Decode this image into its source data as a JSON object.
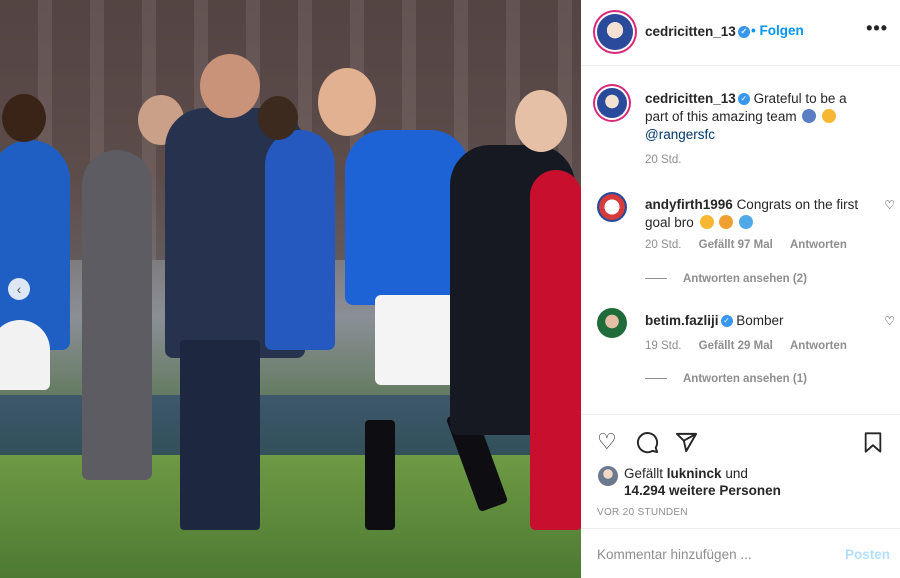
{
  "post": {
    "author": "cedricitten_13",
    "follow_label": "Folgen",
    "more_label": "•••",
    "nav_prev": "‹"
  },
  "comments": [
    {
      "user": "cedricitten_13",
      "verified": true,
      "text": "Grateful to be a part of this amazing team",
      "mention": "@rangersfc",
      "time": "20 Std."
    },
    {
      "user": "andyfirth1996",
      "verified": false,
      "text": "Congrats on the first goal bro",
      "time": "20 Std.",
      "likes": "Gefällt 97 Mal",
      "reply": "Antworten",
      "view_replies": "Antworten ansehen (2)"
    },
    {
      "user": "betim.fazliji",
      "verified": true,
      "text": "Bomber",
      "time": "19 Std.",
      "likes": "Gefällt 29 Mal",
      "reply": "Antworten",
      "view_replies": "Antworten ansehen (1)"
    }
  ],
  "actions": {
    "like_icon": "heart-icon",
    "comment_icon": "comment-icon",
    "share_icon": "share-icon",
    "save_icon": "bookmark-icon"
  },
  "likes": {
    "prefix": "Gefällt",
    "user": "lukninck",
    "connector": "und",
    "count": "14.294 weitere Personen"
  },
  "timestamp": "VOR 20 STUNDEN",
  "add_comment": {
    "placeholder": "Kommentar hinzufügen ...",
    "post_label": "Posten"
  },
  "colors": {
    "accent": "#0095f6",
    "verified": "#3897f0",
    "muted": "#8e8e8e"
  }
}
